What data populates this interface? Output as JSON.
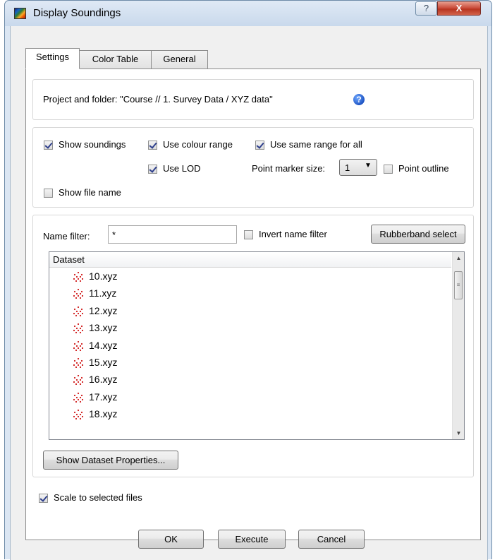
{
  "window": {
    "title": "Display Soundings",
    "help_glyph": "?",
    "close_glyph": "X"
  },
  "tabs": [
    {
      "label": "Settings",
      "active": true
    },
    {
      "label": "Color Table",
      "active": false
    },
    {
      "label": "General",
      "active": false
    }
  ],
  "project": {
    "label": "Project and folder: \"Course // 1. Survey Data / XYZ data\"",
    "help_glyph": "?"
  },
  "options": {
    "show_soundings": {
      "label": "Show soundings",
      "checked": true
    },
    "use_colour_range": {
      "label": "Use colour range",
      "checked": true
    },
    "use_same_range": {
      "label": "Use same range for all",
      "checked": true
    },
    "use_lod": {
      "label": "Use LOD",
      "checked": true
    },
    "point_marker_size_label": "Point marker size:",
    "point_marker_size_value": "1",
    "point_outline": {
      "label": "Point outline",
      "checked": false
    },
    "show_file_name": {
      "label": "Show file name",
      "checked": false
    }
  },
  "filter": {
    "label": "Name filter:",
    "value": "*",
    "invert": {
      "label": "Invert name filter",
      "checked": false
    },
    "rubberband_button": "Rubberband select"
  },
  "dataset_list": {
    "header": "Dataset",
    "items": [
      "10.xyz",
      "11.xyz",
      "12.xyz",
      "13.xyz",
      "14.xyz",
      "15.xyz",
      "16.xyz",
      "17.xyz",
      "18.xyz"
    ],
    "icon": "point-cloud-icon",
    "icon_color": "#d01818"
  },
  "show_properties_button": "Show Dataset Properties...",
  "scale_to_selected": {
    "label": "Scale to selected files",
    "checked": true
  },
  "buttons": {
    "ok": "OK",
    "execute": "Execute",
    "cancel": "Cancel"
  }
}
